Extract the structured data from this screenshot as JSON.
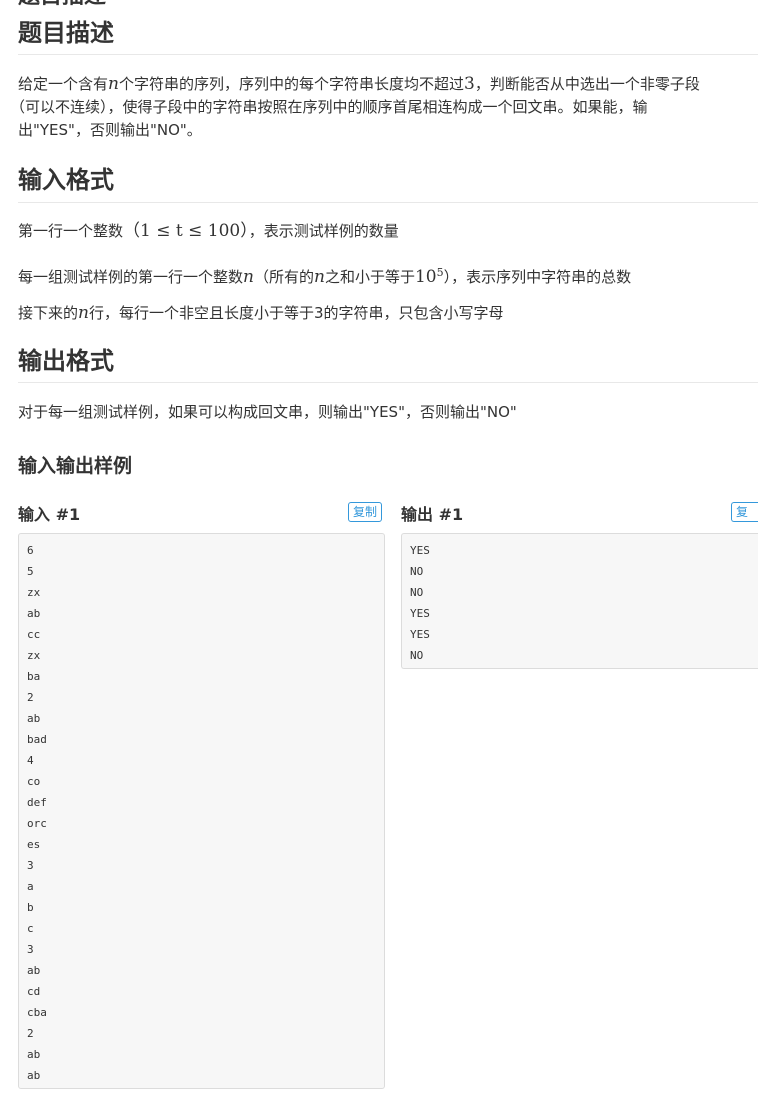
{
  "top_heading": "题目描述",
  "sections": {
    "description": {
      "title": "题目描述",
      "line1_a": "给定一个含有",
      "line1_var": "n",
      "line1_b": "个字符串的序列，序列中的每个字符串长度均不超过",
      "line1_num": "3",
      "line1_c": "，判断能否从中选出一个非零子段",
      "line2": "（可以不连续），使得子段中的字符串按照在序列中的顺序首尾相连构成一个回文串。如果能，输",
      "line3": "出\"YES\"，否则输出\"NO\"。"
    },
    "input_format": {
      "title": "输入格式",
      "p1_a": "第一行一个整数",
      "p1_math_var": "t",
      "p1_math": "（1 ≤ t ≤ 100）",
      "p1_b": "，表示测试样例的数量",
      "p2_a": "每一组测试样例的第一行一个整数",
      "p2_var": "n",
      "p2_b": "（所有的",
      "p2_var2": "n",
      "p2_c": "之和小于等于",
      "p2_pow_base": "10",
      "p2_pow_exp": "5",
      "p2_d": "），表示序列中字符串的总数",
      "p3_a": "接下来的",
      "p3_var": "n",
      "p3_b": "行，每行一个非空且长度小于等于3的字符串，只包含小写字母"
    },
    "output_format": {
      "title": "输出格式",
      "p1": "对于每一组测试样例，如果可以构成回文串，则输出\"YES\"，否则输出\"NO\""
    },
    "samples": {
      "title": "输入输出样例",
      "input_title": "输入 #1",
      "output_title": "输出 #1",
      "copy_label": "复制",
      "input_lines": [
        "6",
        "5",
        "zx",
        "ab",
        "cc",
        "zx",
        "ba",
        "2",
        "ab",
        "bad",
        "4",
        "co",
        "def",
        "orc",
        "es",
        "3",
        "a",
        "b",
        "c",
        "3",
        "ab",
        "cd",
        "cba",
        "2",
        "ab",
        "ab"
      ],
      "output_lines": [
        "YES",
        "NO",
        "NO",
        "YES",
        "YES",
        "NO"
      ]
    }
  },
  "colors": {
    "accent": "#3498db",
    "code_bg": "#f7f7f7",
    "border": "#dcdcdc"
  }
}
